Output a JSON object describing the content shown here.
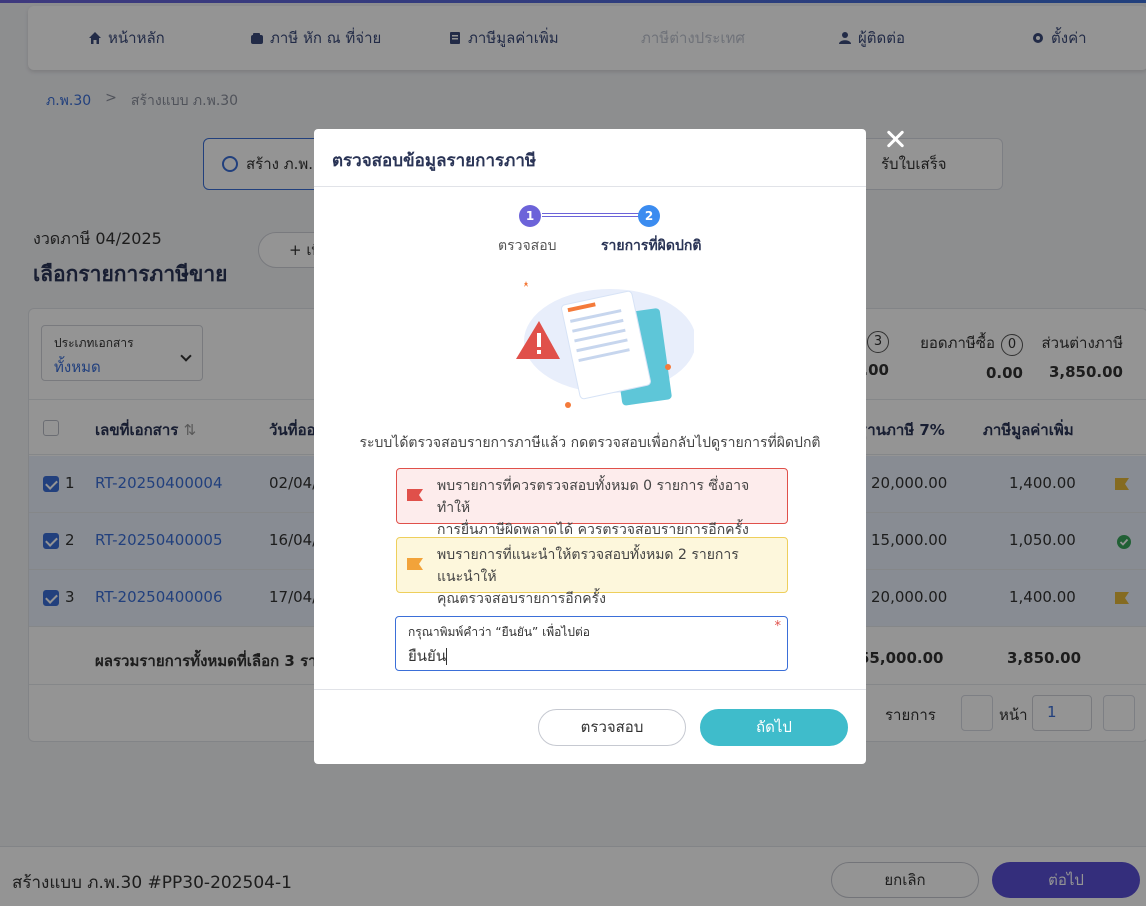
{
  "nav": {
    "items": [
      {
        "label": "หน้าหลัก",
        "icon": "home-icon"
      },
      {
        "label": "ภาษี หัก ณ ที่จ่าย",
        "icon": "wallet-icon"
      },
      {
        "label": "ภาษีมูลค่าเพิ่ม",
        "icon": "document-icon"
      },
      {
        "label": "ภาษีต่างประเทศ",
        "icon": ""
      },
      {
        "label": "ผู้ติดต่อ",
        "icon": "user-icon"
      },
      {
        "label": "ตั้งค่า",
        "icon": "gear-icon"
      }
    ]
  },
  "breadcrumb": {
    "root": "ภ.พ.30",
    "separator": ">",
    "current": "สร้างแบบ ภ.พ.30"
  },
  "steps": {
    "first": "สร้าง ภ.พ.3",
    "last": "รับใบเสร็จ"
  },
  "page": {
    "period": "งวดภาษี 04/2025",
    "heading": "เลือกรายการภาษีขาย",
    "add_button": "+ เพิ"
  },
  "filter": {
    "label": "ประเภทเอกสาร",
    "value": "ทั้งหมด"
  },
  "summary": {
    "first_badge": "3",
    "first_value": ".00",
    "purchase_label": "ยอดภาษีซื้อ",
    "purchase_badge": "0",
    "purchase_value": "0.00",
    "diff_label": "ส่วนต่างภาษี",
    "diff_value": "3,850.00"
  },
  "table": {
    "headers": {
      "doc_no": "เลขที่เอกสาร",
      "date": "วันที่ออ",
      "base": "ฐานภาษี 7%",
      "vat": "ภาษีมูลค่าเพิ่ม"
    },
    "rows": [
      {
        "index": "1",
        "doc": "RT-20250400004",
        "date": "02/04/",
        "base": "20,000.00",
        "vat": "1,400.00",
        "status": "flag"
      },
      {
        "index": "2",
        "doc": "RT-20250400005",
        "date": "16/04/",
        "base": "15,000.00",
        "vat": "1,050.00",
        "status": "check"
      },
      {
        "index": "3",
        "doc": "RT-20250400006",
        "date": "17/04/",
        "base": "20,000.00",
        "vat": "1,400.00",
        "status": "flag"
      }
    ],
    "total": {
      "label": "ผลรวมรายการทั้งหมดที่เลือก 3 รายกา",
      "base": "55,000.00",
      "vat": "3,850.00"
    }
  },
  "pager": {
    "items_label": "รายการ",
    "page_label": "หน้า",
    "page_value": "1"
  },
  "footer": {
    "title": "สร้างแบบ ภ.พ.30 #PP30-202504-1",
    "cancel": "ยกเลิก",
    "next": "ต่อไป"
  },
  "modal": {
    "title": "ตรวจสอบข้อมูลรายการภาษี",
    "steps": [
      {
        "num": "1",
        "label": "ตรวจสอบ"
      },
      {
        "num": "2",
        "label": "รายการที่ผิดปกติ"
      }
    ],
    "message": "ระบบได้ตรวจสอบรายการภาษีแล้ว กดตรวจสอบเพื่อกลับไปดูรายการที่ผิดปกติ",
    "alert_error_line1": "พบรายการที่ควรตรวจสอบทั้งหมด 0 รายการ ซึ่งอาจทำให้",
    "alert_error_line2": "การยื่นภาษีผิดพลาดได้ ควรตรวจสอบรายการอีกครั้ง",
    "alert_warn_line1": "พบรายการที่แนะนำให้ตรวจสอบทั้งหมด 2 รายการ แนะนำให้",
    "alert_warn_line2": "คุณตรวจสอบรายการอีกครั้ง",
    "input_label": "กรุณาพิมพ์คำว่า “ยืนยัน” เพื่อไปต่อ",
    "input_required": "*",
    "input_value": "ยืนยัน",
    "check_button": "ตรวจสอบ",
    "next_button": "ถัดไป"
  },
  "colors": {
    "primary": "#3b6fd8",
    "accent": "#5b50d6",
    "teal": "#3fbccb",
    "error": "#e0504a",
    "warning": "#eecf5c"
  }
}
